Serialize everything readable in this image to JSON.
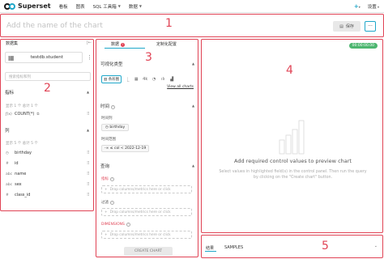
{
  "nav": {
    "brand": "Superset",
    "items": [
      "看板",
      "图表",
      "SQL 工具箱",
      "数据"
    ],
    "right": [
      "设置"
    ]
  },
  "header": {
    "placeholder": "Add the name of the chart",
    "save_label": "保存",
    "more_label": "···"
  },
  "annotations": [
    "1",
    "2",
    "3",
    "4",
    "5"
  ],
  "datasource": {
    "title": "数据集",
    "name": "testdb.student",
    "search_placeholder": "搜索指标和列",
    "metrics_title": "指标",
    "metrics_count": "显示 1 个 总计 1 个",
    "metrics": [
      {
        "icon": "ƒ(x)",
        "name": "COUNT(*)"
      }
    ],
    "columns_title": "列",
    "columns_count": "显示 5 个 总计 5 个",
    "columns": [
      {
        "icon": "◷",
        "name": "birthday"
      },
      {
        "icon": "#",
        "name": "id"
      },
      {
        "icon": "abc",
        "name": "name"
      },
      {
        "icon": "abc",
        "name": "sex"
      },
      {
        "icon": "#",
        "name": "class_id"
      }
    ]
  },
  "control": {
    "tabs": [
      "数据",
      "定制化配置"
    ],
    "error_count": "!",
    "viz_section": "可视化类型",
    "viz_selected": "条形图",
    "viz_icons": [
      "⎿",
      "▦",
      "4k",
      "◔",
      "ılı",
      "▟"
    ],
    "view_all": "View all charts",
    "time_section": "时间",
    "time_col_label": "时间列",
    "time_col_value": "birthday",
    "time_range_label": "时间范围",
    "time_range_value": "-∞ ≤ col < 2022-12-19",
    "query_section": "查询",
    "metrics_label": "指标",
    "metrics_drop": "Drop columns/metrics here or click",
    "filters_label": "过滤",
    "filters_drop": "Drop columns/metrics here or click",
    "dimensions_label": "DIMENSIONS",
    "dimensions_drop": "Drop columns/metrics here or click",
    "create_btn": "CREATE CHART"
  },
  "chart": {
    "timer": "00:00:00.00",
    "empty_title": "Add required control values to preview chart",
    "empty_desc": "Select values in highlighted field(s) in the control panel. Then run the query by clicking on the \"Create chart\" button."
  },
  "results": {
    "tabs": [
      "结果",
      "SAMPLES"
    ]
  }
}
